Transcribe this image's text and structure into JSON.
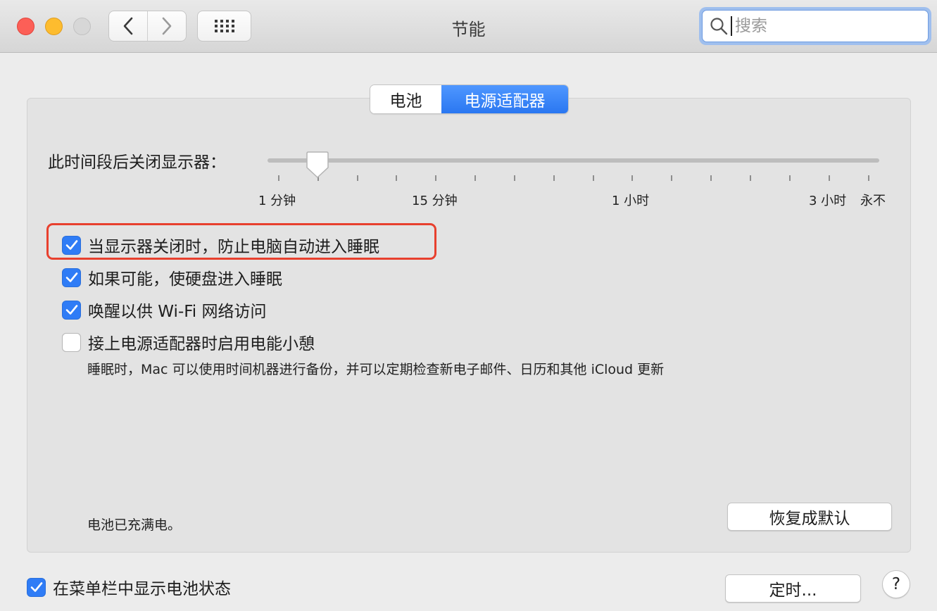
{
  "window": {
    "title": "节能"
  },
  "toolbar": {
    "back_icon": "chevron-left-icon",
    "forward_icon": "chevron-right-icon",
    "grid_icon": "grid-icon"
  },
  "search": {
    "placeholder": "搜索",
    "value": "",
    "icon": "magnifier-icon"
  },
  "tabs": [
    {
      "label": "电池",
      "selected": false
    },
    {
      "label": "电源适配器",
      "selected": true
    }
  ],
  "display_sleep": {
    "label": "此时间段后关闭显示器：",
    "tick_labels": [
      "1 分钟",
      "15 分钟",
      "1 小时",
      "3 小时",
      "永不"
    ],
    "current": "1 分钟"
  },
  "options": [
    {
      "label": "当显示器关闭时，防止电脑自动进入睡眠",
      "checked": true
    },
    {
      "label": "如果可能，使硬盘进入睡眠",
      "checked": true
    },
    {
      "label": "唤醒以供 Wi-Fi 网络访问",
      "checked": true
    },
    {
      "label": "接上电源适配器时启用电能小憩",
      "checked": false
    }
  ],
  "power_nap_note": "睡眠时，Mac 可以使用时间机器进行备份，并可以定期检查新电子邮件、日历和其他 iCloud 更新",
  "battery_status": "电池已充满电。",
  "restore_defaults_label": "恢复成默认",
  "show_in_menubar": {
    "label": "在菜单栏中显示电池状态",
    "checked": true
  },
  "schedule_label": "定时...",
  "help_label": "?",
  "colors": {
    "accent": "#2f7cf6",
    "highlight_border": "#e8402e",
    "close": "#fc5f57",
    "minimize": "#fdbc2e"
  }
}
